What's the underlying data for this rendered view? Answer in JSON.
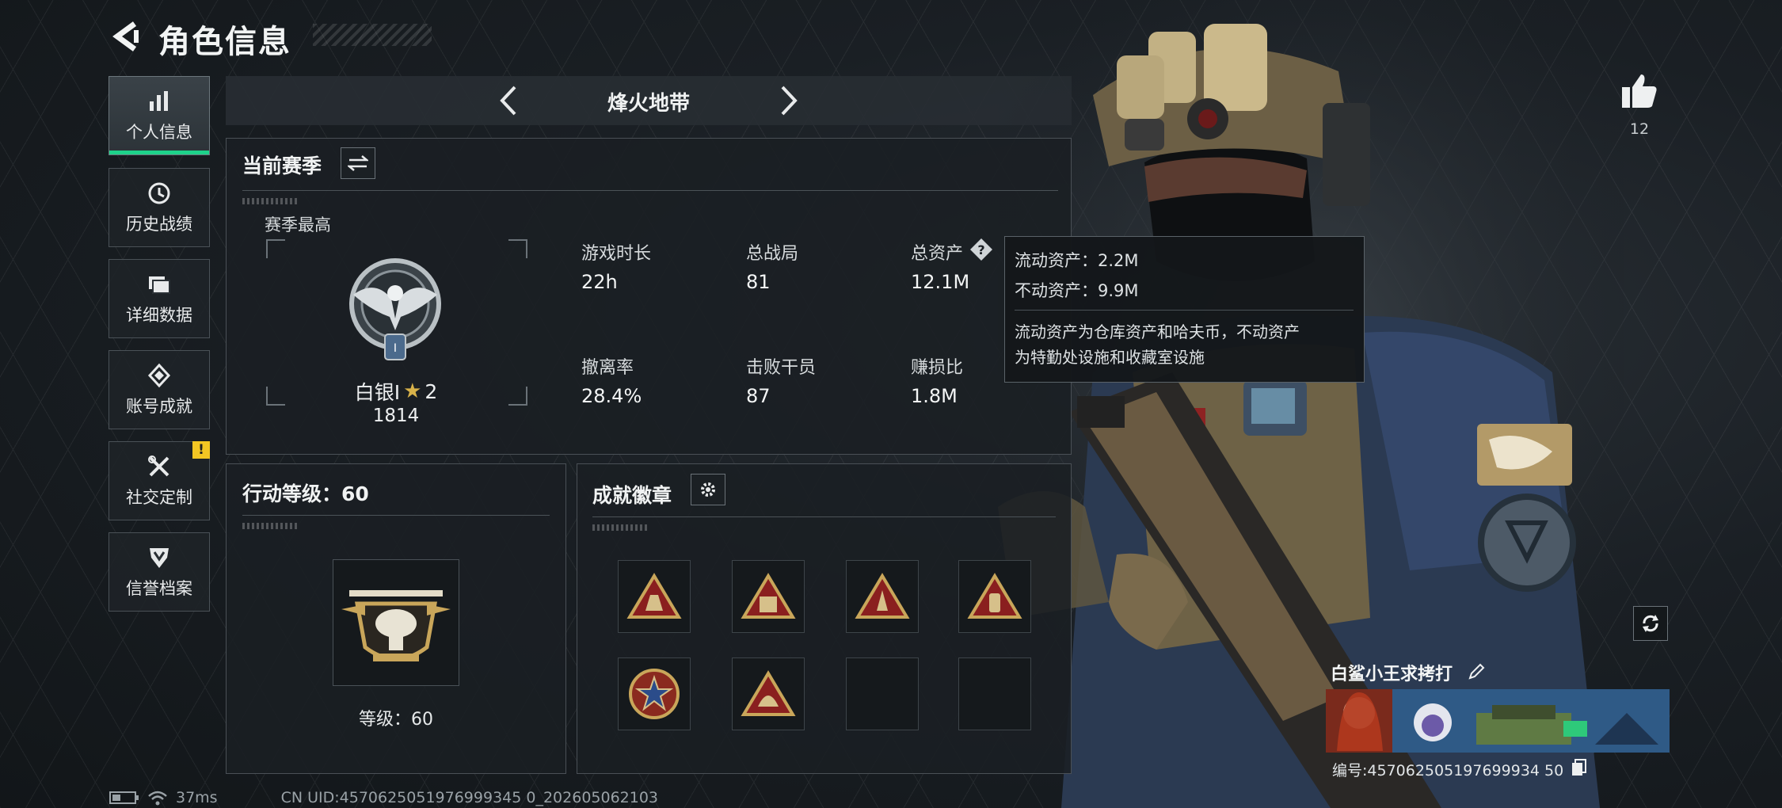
{
  "header": {
    "title": "角色信息"
  },
  "sidebar": {
    "items": [
      {
        "label": "个人信息",
        "icon": "bar-chart-icon",
        "active": true
      },
      {
        "label": "历史战绩",
        "icon": "history-icon"
      },
      {
        "label": "详细数据",
        "icon": "folder-icon"
      },
      {
        "label": "账号成就",
        "icon": "achievement-icon"
      },
      {
        "label": "社交定制",
        "icon": "tools-icon",
        "badge": "!"
      },
      {
        "label": "信誉档案",
        "icon": "shield-icon"
      }
    ]
  },
  "mode": {
    "title": "烽火地带"
  },
  "season": {
    "title": "当前赛季",
    "best_label": "赛季最高",
    "rank_name": "白银I",
    "rank_stars": "2",
    "rank_score": "1814",
    "stats": [
      {
        "label": "游戏时长",
        "value": "22h"
      },
      {
        "label": "总战局",
        "value": "81"
      },
      {
        "label": "总资产",
        "value": "12.1M"
      },
      {
        "label": "撤离率",
        "value": "28.4%"
      },
      {
        "label": "击败干员",
        "value": "87"
      },
      {
        "label": "赚损比",
        "value": "1.8M"
      }
    ],
    "help_icon": "?"
  },
  "tooltip": {
    "liquid": "流动资产：2.2M",
    "fixed": "不动资产：9.9M",
    "desc_1": "流动资产为仓库资产和哈夫币，不动资产",
    "desc_2": "为特勤处设施和收藏室设施"
  },
  "action_level": {
    "title": "行动等级：60",
    "level_text": "等级：60"
  },
  "achievements": {
    "title": "成就徽章"
  },
  "profile": {
    "like_count": "12",
    "player_name": "白鲨小王求拷打",
    "player_id": "编号:457062505197699934 50"
  },
  "status": {
    "ping": "37ms",
    "uid": "CN UID:4570625051976999345 0_202605062103"
  },
  "colors": {
    "accent": "#1ed28a",
    "warning": "#f3c623",
    "panel_border": "#4a5056"
  }
}
